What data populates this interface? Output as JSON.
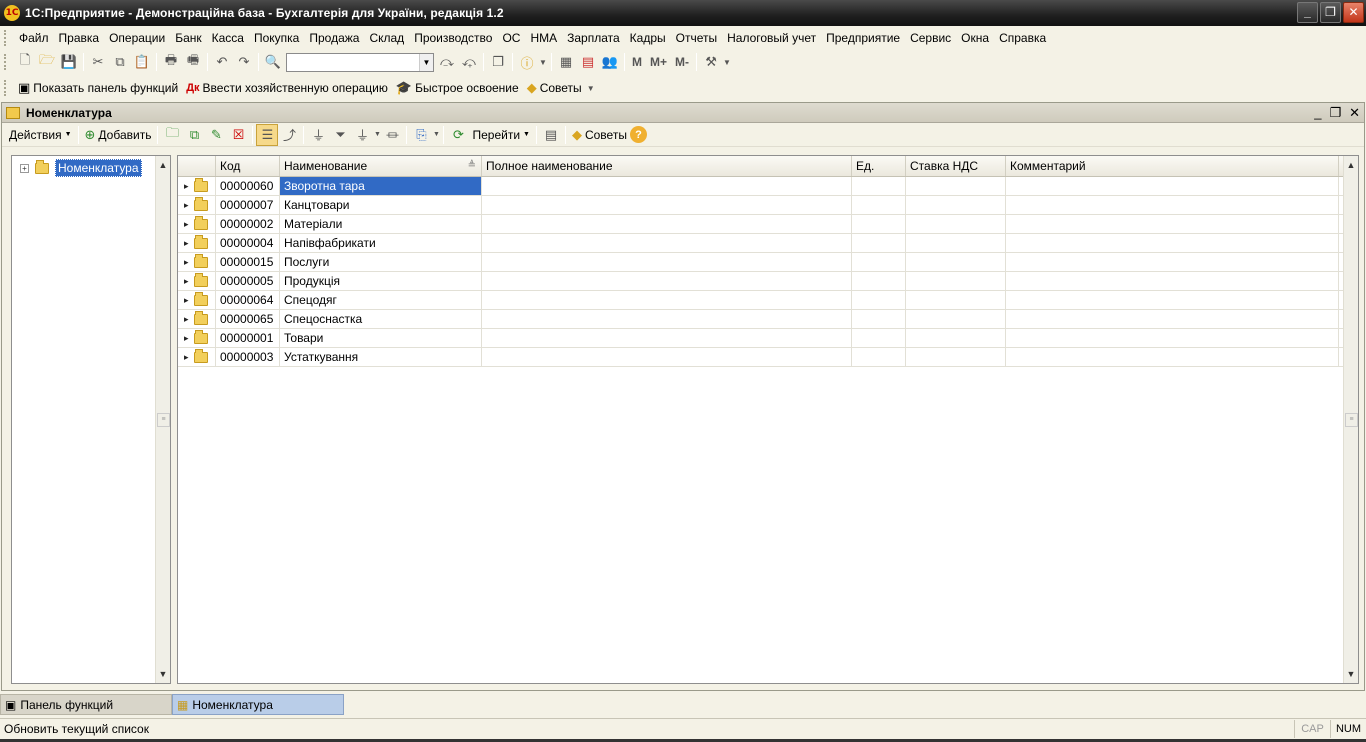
{
  "window": {
    "title": "1С:Предприятие - Демонстраційна база - Бухгалтерія для України, редакція 1.2"
  },
  "menu": [
    "Файл",
    "Правка",
    "Операции",
    "Банк",
    "Касса",
    "Покупка",
    "Продажа",
    "Склад",
    "Производство",
    "ОС",
    "НМА",
    "Зарплата",
    "Кадры",
    "Отчеты",
    "Налоговый учет",
    "Предприятие",
    "Сервис",
    "Окна",
    "Справка"
  ],
  "toolbar1": {
    "search_value": "",
    "m_label": "M",
    "mplus_label": "M+",
    "mminus_label": "M-"
  },
  "toolbar2": {
    "show_panel": "Показать панель функций",
    "enter_operation": "Ввести хозяйственную операцию",
    "quick_learning": "Быстрое освоение",
    "tips": "Советы"
  },
  "doc": {
    "title": "Номенклатура",
    "actions": "Действия",
    "add": "Добавить",
    "goto": "Перейти",
    "tips": "Советы"
  },
  "tree": {
    "root": "Номенклатура"
  },
  "grid": {
    "columns": [
      "Код",
      "Наименование",
      "Полное наименование",
      "Ед.",
      "Ставка НДС",
      "Комментарий"
    ],
    "rows": [
      {
        "code": "00000060",
        "name": "Зворотна тара"
      },
      {
        "code": "00000007",
        "name": "Канцтовари"
      },
      {
        "code": "00000002",
        "name": "Матеріали"
      },
      {
        "code": "00000004",
        "name": "Напівфабрикати"
      },
      {
        "code": "00000015",
        "name": "Послуги"
      },
      {
        "code": "00000005",
        "name": "Продукція"
      },
      {
        "code": "00000064",
        "name": "Спецодяг"
      },
      {
        "code": "00000065",
        "name": "Спецоснастка"
      },
      {
        "code": "00000001",
        "name": "Товари"
      },
      {
        "code": "00000003",
        "name": "Устаткування"
      }
    ]
  },
  "tabs": {
    "functions_panel": "Панель функций",
    "nomenclature": "Номенклатура"
  },
  "status": {
    "message": "Обновить текущий список",
    "cap": "CAP",
    "num": "NUM"
  }
}
